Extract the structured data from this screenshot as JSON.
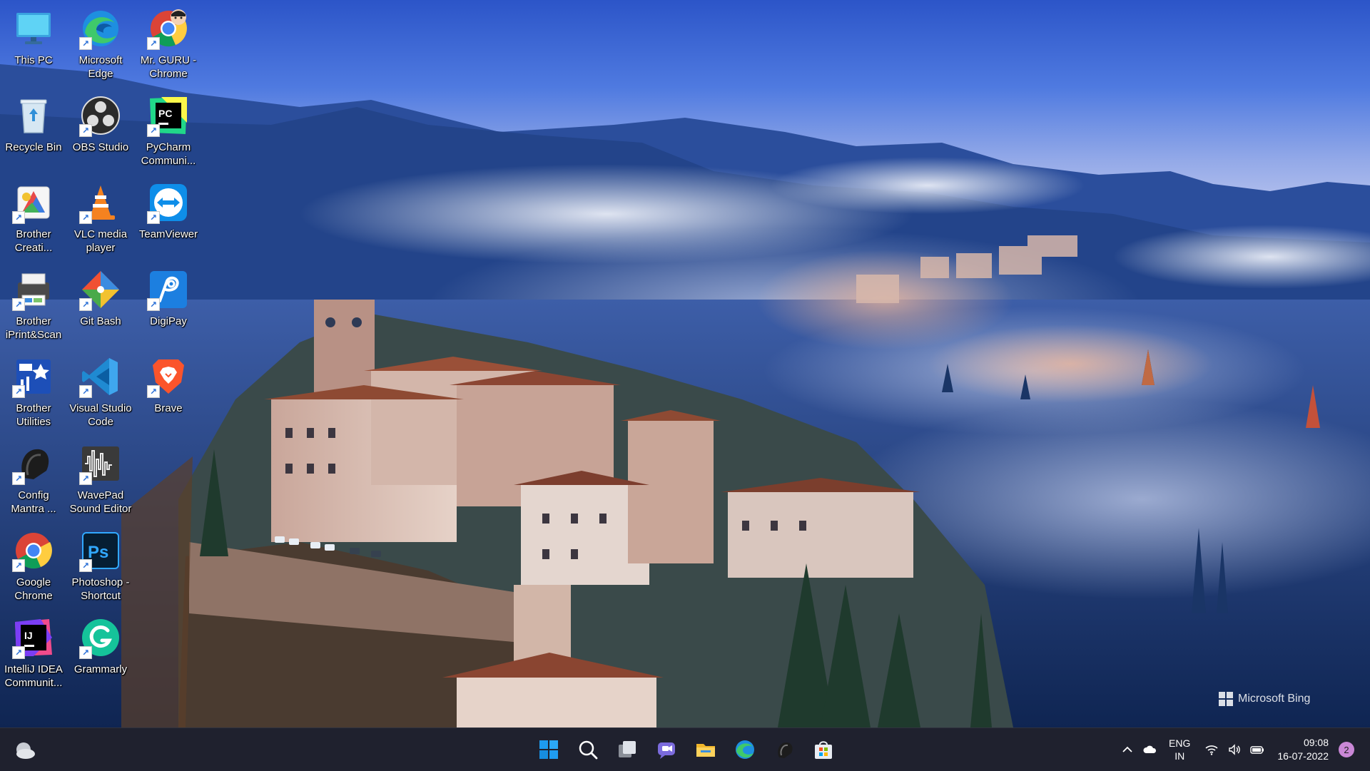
{
  "desktop": {
    "icons": [
      {
        "label": "This PC",
        "icon": "this-pc-icon",
        "shortcut": false
      },
      {
        "label": "Microsoft\nEdge",
        "icon": "edge-icon",
        "shortcut": true
      },
      {
        "label": "Mr. GURU -\nChrome",
        "icon": "chrome-profile-icon",
        "shortcut": true
      },
      {
        "label": "Recycle Bin",
        "icon": "recycle-bin-icon",
        "shortcut": false
      },
      {
        "label": "OBS Studio",
        "icon": "obs-icon",
        "shortcut": true
      },
      {
        "label": "PyCharm\nCommuni...",
        "icon": "pycharm-icon",
        "shortcut": true
      },
      {
        "label": "Brother\nCreati...",
        "icon": "brother-creative-icon",
        "shortcut": true
      },
      {
        "label": "VLC media\nplayer",
        "icon": "vlc-icon",
        "shortcut": true
      },
      {
        "label": "TeamViewer",
        "icon": "teamviewer-icon",
        "shortcut": true
      },
      {
        "label": "Brother\niPrint&Scan",
        "icon": "brother-iprint-icon",
        "shortcut": true
      },
      {
        "label": "Git Bash",
        "icon": "git-bash-icon",
        "shortcut": true
      },
      {
        "label": "DigiPay",
        "icon": "digipay-icon",
        "shortcut": true
      },
      {
        "label": "Brother\nUtilities",
        "icon": "brother-utilities-icon",
        "shortcut": true
      },
      {
        "label": "Visual Studio\nCode",
        "icon": "vscode-icon",
        "shortcut": true
      },
      {
        "label": "Brave",
        "icon": "brave-icon",
        "shortcut": true
      },
      {
        "label": "Config\nMantra ...",
        "icon": "config-mantra-icon",
        "shortcut": true
      },
      {
        "label": "WavePad\nSound Editor",
        "icon": "wavepad-icon",
        "shortcut": true
      },
      {
        "label": "Google\nChrome",
        "icon": "chrome-icon",
        "shortcut": true
      },
      {
        "label": "Photoshop -\nShortcut",
        "icon": "photoshop-icon",
        "shortcut": true
      },
      {
        "label": "IntelliJ IDEA\nCommunit...",
        "icon": "intellij-icon",
        "shortcut": true
      },
      {
        "label": "Grammarly",
        "icon": "grammarly-icon",
        "shortcut": true
      }
    ],
    "watermark": "Microsoft Bing"
  },
  "taskbar": {
    "pinned": [
      "start-icon",
      "search-icon",
      "task-view-icon",
      "chat-icon",
      "file-explorer-icon",
      "edge-icon",
      "obs-icon",
      "store-icon"
    ],
    "tray": {
      "language_line1": "ENG",
      "language_line2": "IN",
      "time": "09:08",
      "date": "16-07-2022",
      "notification_count": "2"
    }
  },
  "colors": {
    "taskbar_bg": "#202028",
    "accent": "#3b8eea",
    "notification_badge": "#c987d6"
  }
}
